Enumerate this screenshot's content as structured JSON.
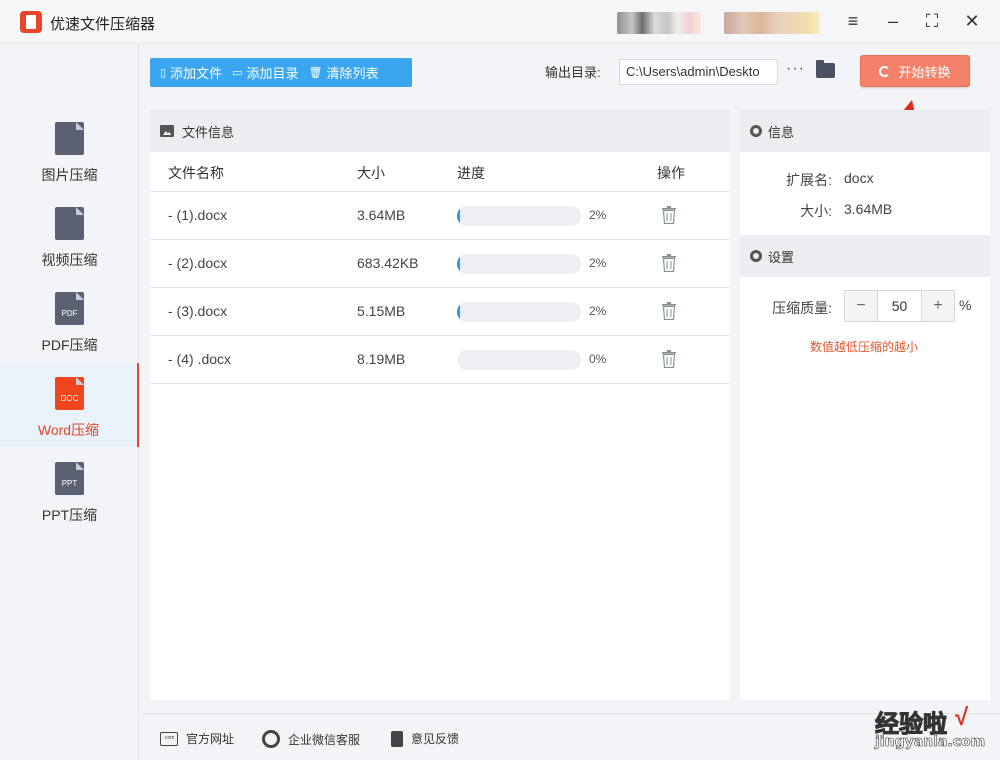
{
  "app": {
    "title": "优速文件压缩器"
  },
  "sidebar": {
    "items": [
      {
        "label": "图片压缩",
        "icon_text": "",
        "icon": "image-file-icon",
        "active": false
      },
      {
        "label": "视频压缩",
        "icon_text": "",
        "icon": "video-file-icon",
        "active": false
      },
      {
        "label": "PDF压缩",
        "icon_text": "PDF",
        "icon": "pdf-file-icon",
        "active": false
      },
      {
        "label": "Word压缩",
        "icon_text": "DOC",
        "icon": "doc-file-icon",
        "active": true
      },
      {
        "label": "PPT压缩",
        "icon_text": "PPT",
        "icon": "ppt-file-icon",
        "active": false
      }
    ]
  },
  "toolbar": {
    "add_file": "添加文件",
    "add_dir": "添加目录",
    "clear_list": "清除列表",
    "output_label": "输出目录:",
    "output_path": "C:\\Users\\admin\\Deskto",
    "more": "···",
    "start": "开始转换"
  },
  "file_panel": {
    "title": "文件信息",
    "columns": {
      "name": "文件名称",
      "size": "大小",
      "progress": "进度",
      "action": "操作"
    },
    "rows": [
      {
        "name": "- (1).docx",
        "size": "3.64MB",
        "progress": 0.02,
        "progress_text": "2%"
      },
      {
        "name": "- (2).docx",
        "size": "683.42KB",
        "progress": 0.02,
        "progress_text": "2%"
      },
      {
        "name": "- (3).docx",
        "size": "5.15MB",
        "progress": 0.02,
        "progress_text": "2%"
      },
      {
        "name": "- (4) .docx",
        "size": "8.19MB",
        "progress": 0.0,
        "progress_text": "0%"
      }
    ]
  },
  "info_panel": {
    "title": "信息",
    "ext_label": "扩展名:",
    "ext_value": "docx",
    "size_label": "大小:",
    "size_value": "3.64MB"
  },
  "settings_panel": {
    "title": "设置",
    "quality_label": "压缩质量:",
    "minus": "−",
    "quality_value": "50",
    "plus": "+",
    "unit": "%",
    "hint": "数值越低压缩的越小"
  },
  "footer": {
    "website": "官方网址",
    "wechat": "企业微信客服",
    "feedback": "意见反馈",
    "website_icon_text": ".com"
  },
  "watermark": {
    "top": "经验啦",
    "check": "√",
    "bottom": "jingyanla.com"
  },
  "colors": {
    "accent": "#3aa6f0",
    "start": "#f4826b",
    "active": "#e8452b",
    "progress": "#3a8fe6"
  }
}
